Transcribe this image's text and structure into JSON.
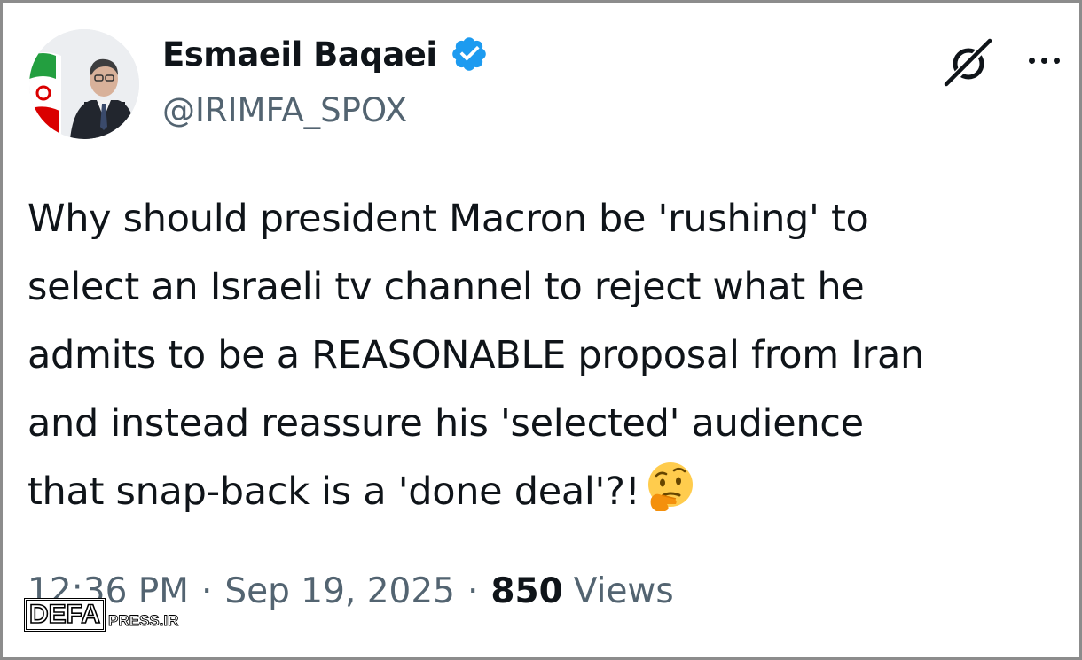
{
  "author": {
    "display_name": "Esmaeil Baqaei",
    "handle": "@IRIMFA_SPOX",
    "verified": true
  },
  "tweet": {
    "lines": [
      "Why should president Macron be 'rushing' to",
      "select an Israeli tv channel to reject what he",
      "admits to be a REASONABLE proposal from Iran",
      "and instead reassure his 'selected' audience",
      "that snap-back is a 'done deal'?!"
    ],
    "emoji": "thinking-face"
  },
  "meta": {
    "time": "12:36 PM",
    "separator": "·",
    "date": "Sep 19, 2025",
    "views_count": "850",
    "views_label": "Views"
  },
  "icons": {
    "verified_badge": "verified-badge-icon",
    "grok": "grok-icon",
    "more": "more-options-icon"
  },
  "colors": {
    "verified_blue": "#1d9bf0",
    "text_primary": "#0f1419",
    "text_secondary": "#536471"
  },
  "watermark": {
    "box_text": "DEFA",
    "rest_text": "PRESS.IR"
  }
}
